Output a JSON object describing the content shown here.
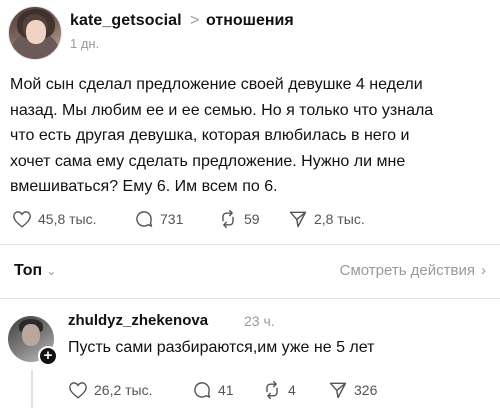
{
  "post": {
    "username": "kate_getsocial",
    "separator": ">",
    "topic": "отношения",
    "time": "1 дн.",
    "lines": [
      "Мой сын сделал предложение своей девушке 4 недели",
      "назад. Мы любим ее и ее семью. Но я только что узнала",
      "что есть другая девушка, которая влюбилась в него и",
      "хочет сама ему сделать предложение. Нужно ли мне",
      "вмешиваться? Ему 6. Им всем по 6."
    ],
    "stats": {
      "likes": "45,8 тыс.",
      "comments": "731",
      "reposts": "59",
      "shares": "2,8 тыс."
    },
    "icons": {
      "avatar": "avatar-photo",
      "like": "heart-icon",
      "comment": "comment-bubble-icon",
      "repost": "repost-icon",
      "share": "send-icon"
    }
  },
  "sort": {
    "label": "Топ",
    "chevron": "⌄",
    "view_actions": "Смотреть действия",
    "view_chevron": "›"
  },
  "reply": {
    "username": "zhuldyz_zhekenova",
    "time": "23 ч.",
    "text": "Пусть сами разбираются,им уже не 5 лет",
    "follow": "+",
    "stats": {
      "likes": "26,2 тыс.",
      "comments": "41",
      "reposts": "4",
      "shares": "326"
    }
  },
  "colors": {
    "text": "#111111",
    "muted": "#9a9a9a",
    "icon": "#555555",
    "divider": "#e3e3e3"
  }
}
